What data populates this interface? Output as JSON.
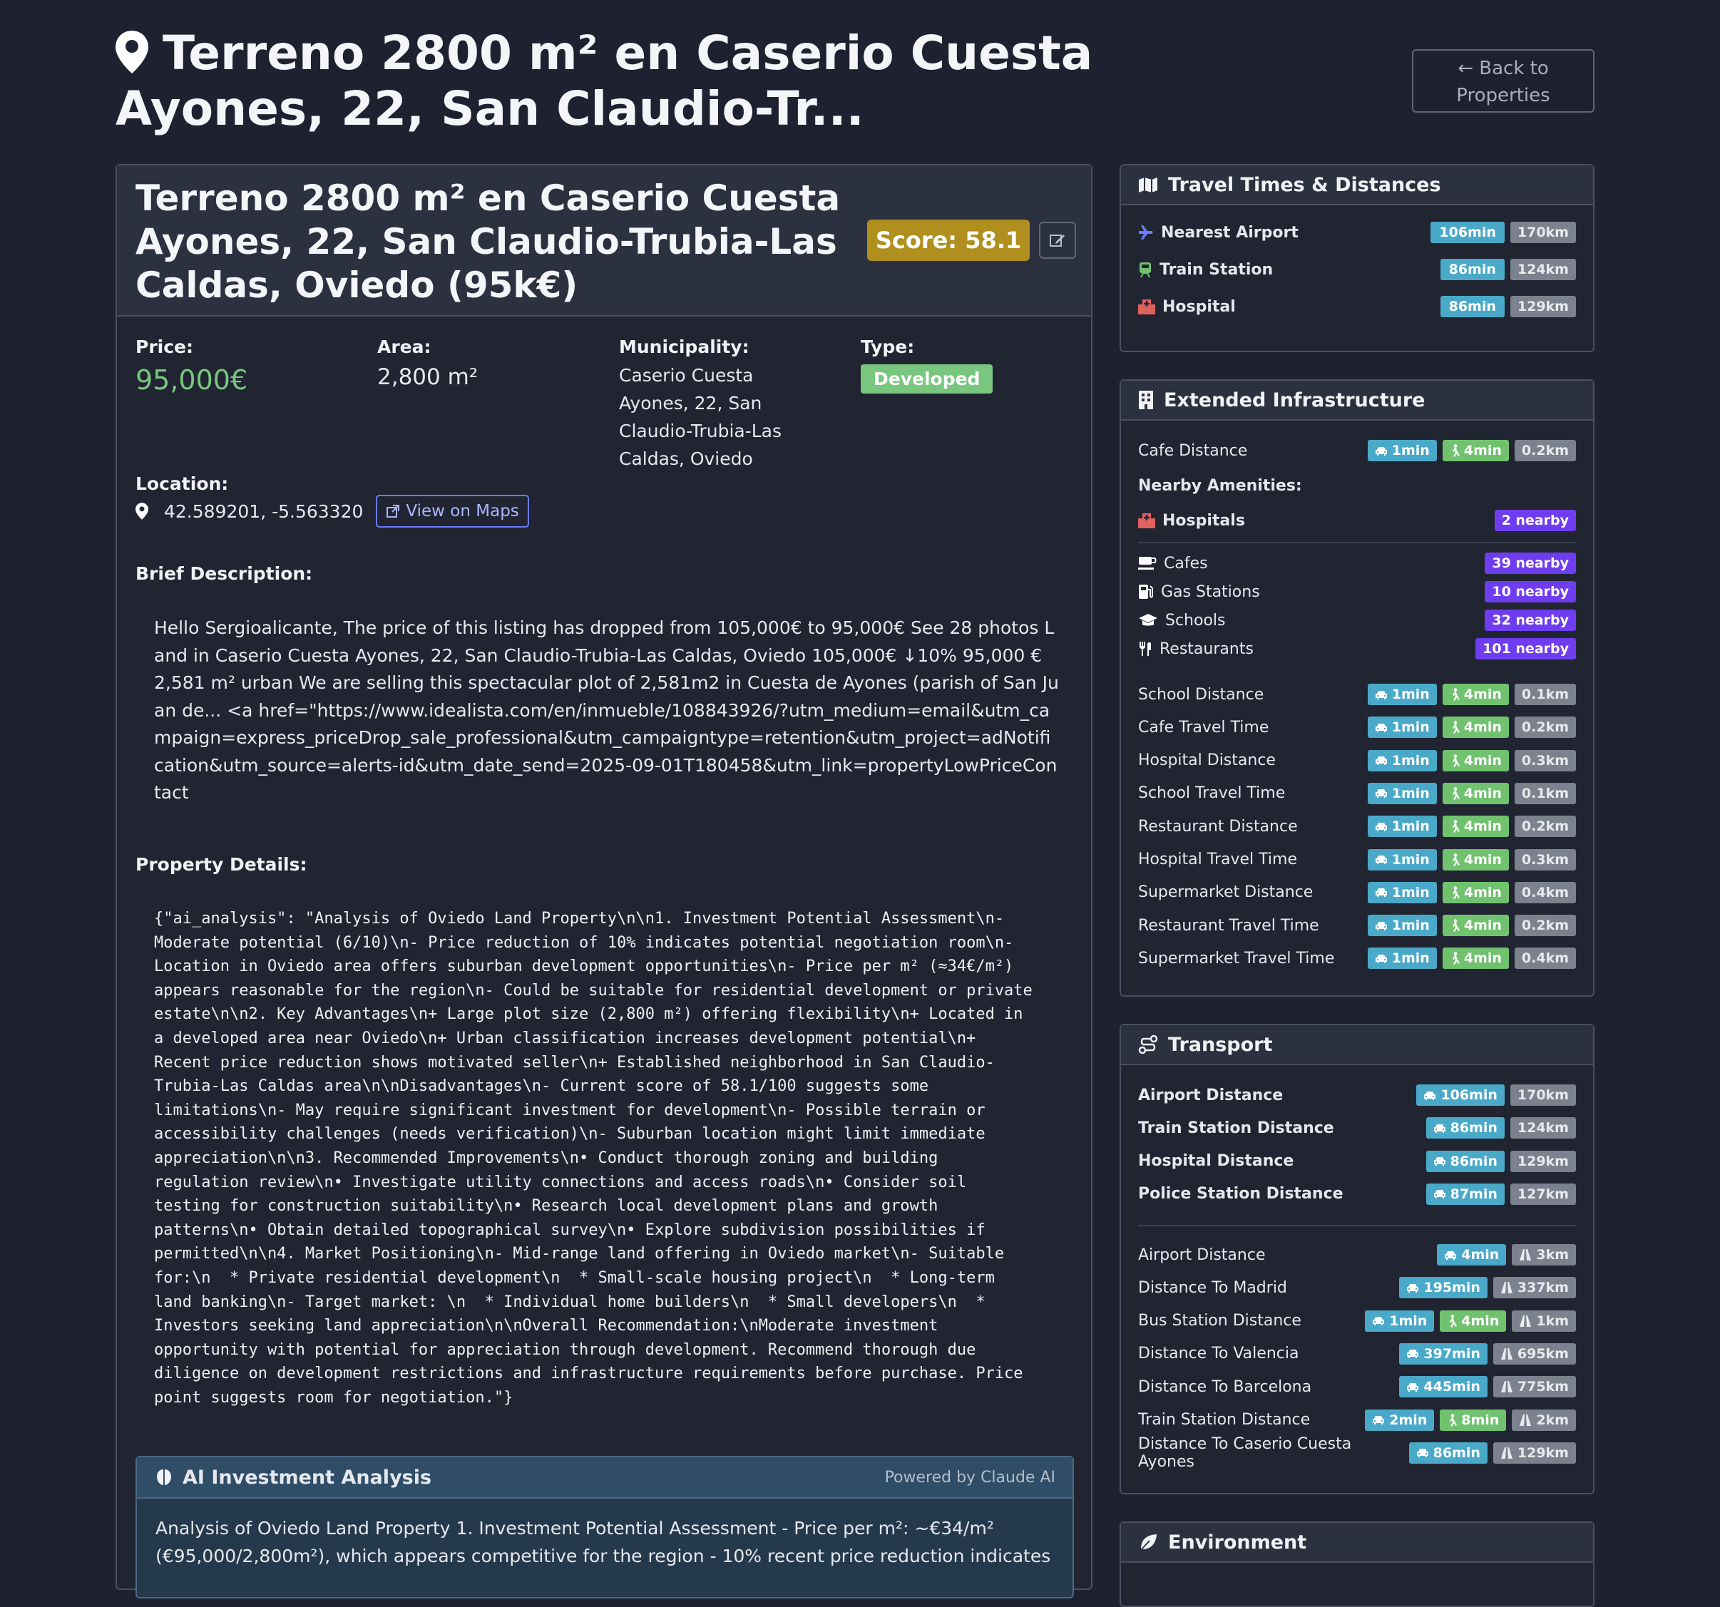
{
  "page": {
    "title": "Terreno 2800 m² en Caserio Cuesta Ayones, 22, San Claudio-Tr...",
    "back_label": "Back to Properties"
  },
  "property": {
    "heading": "Terreno 2800 m² en Caserio Cuesta Ayones, 22, San Claudio-Trubia-Las Caldas, Oviedo (95k€)",
    "score_label": "Score: 58.1",
    "price_label": "Price:",
    "price": "95,000€",
    "area_label": "Area:",
    "area": "2,800 m²",
    "municipality_label": "Municipality:",
    "municipality": "Caserio Cuesta Ayones, 22, San Claudio-Trubia-Las Caldas, Oviedo",
    "type_label": "Type:",
    "type": "Developed",
    "location_label": "Location:",
    "coords": "42.589201, -5.563320",
    "maps_label": "View on Maps",
    "brief_label": "Brief Description:",
    "brief": "Hello Sergioalicante, The price of this listing has dropped from 105,000€ to 95,000€ See 28 photos Land in Caserio Cuesta Ayones, 22, San Claudio-Trubia-Las Caldas, Oviedo 105,000€ ↓10% 95,000 € 2,581 m² urban We are selling this spectacular plot of 2,581m2 in Cuesta de Ayones (parish of San Juan de... <a href=\"https://www.idealista.com/en/inmueble/108843926/?utm_medium=email&utm_campaign=express_priceDrop_sale_professional&utm_campaigntype=retention&utm_project=adNotification&utm_source=alerts-id&utm_date_send=2025-09-01T180458&utm_link=propertyLowPriceContact",
    "details_label": "Property Details:",
    "details": "{\"ai_analysis\": \"Analysis of Oviedo Land Property\\n\\n1. Investment Potential Assessment\\n-\nModerate potential (6/10)\\n- Price reduction of 10% indicates potential negotiation room\\n-\nLocation in Oviedo area offers suburban development opportunities\\n- Price per m² (≈34€/m²)\nappears reasonable for the region\\n- Could be suitable for residential development or private\nestate\\n\\n2. Key Advantages\\n+ Large plot size (2,800 m²) offering flexibility\\n+ Located in\na developed area near Oviedo\\n+ Urban classification increases development potential\\n+\nRecent price reduction shows motivated seller\\n+ Established neighborhood in San Claudio-\nTrubia-Las Caldas area\\n\\nDisadvantages\\n- Current score of 58.1/100 suggests some\nlimitations\\n- May require significant investment for development\\n- Possible terrain or\naccessibility challenges (needs verification)\\n- Suburban location might limit immediate\nappreciation\\n\\n3. Recommended Improvements\\n• Conduct thorough zoning and building\nregulation review\\n• Investigate utility connections and access roads\\n• Consider soil\ntesting for construction suitability\\n• Research local development plans and growth\npatterns\\n• Obtain detailed topographical survey\\n• Explore subdivision possibilities if\npermitted\\n\\n4. Market Positioning\\n- Mid-range land offering in Oviedo market\\n- Suitable\nfor:\\n  * Private residential development\\n  * Small-scale housing project\\n  * Long-term\nland banking\\n- Target market: \\n  * Individual home builders\\n  * Small developers\\n  *\nInvestors seeking land appreciation\\n\\nOverall Recommendation:\\nModerate investment\nopportunity with potential for appreciation through development. Recommend thorough due\ndiligence on development restrictions and infrastructure requirements before purchase. Price\npoint suggests room for negotiation.\"}",
    "ai_title": "AI Investment Analysis",
    "ai_powered": "Powered by Claude AI",
    "ai_text": "Analysis of Oviedo Land Property 1. Investment Potential Assessment - Price per m²: ~€34/m² (€95,000/2,800m²), which appears competitive for the region - 10% recent price reduction indicates"
  },
  "travel": {
    "title": "Travel Times & Distances",
    "rows": [
      {
        "label": "Nearest Airport",
        "time": "106min",
        "dist": "170km",
        "icon": "plane-icon",
        "color": "#6b7cff"
      },
      {
        "label": "Train Station",
        "time": "86min",
        "dist": "124km",
        "icon": "train-icon",
        "color": "#71c26f"
      },
      {
        "label": "Hospital",
        "time": "86min",
        "dist": "129km",
        "icon": "hospital-icon",
        "color": "#e0625e"
      }
    ]
  },
  "infra": {
    "title": "Extended Infrastructure",
    "cafe": {
      "label": "Cafe Distance",
      "drive": "1min",
      "walk": "4min",
      "dist": "0.2km"
    },
    "amenities_label": "Nearby Amenities:",
    "hospitals": {
      "label": "Hospitals",
      "count": "2 nearby"
    },
    "amenities": [
      {
        "label": "Cafes",
        "count": "39 nearby",
        "icon": "coffee-icon"
      },
      {
        "label": "Gas Stations",
        "count": "10 nearby",
        "icon": "gas-pump-icon"
      },
      {
        "label": "Schools",
        "count": "32 nearby",
        "icon": "graduation-cap-icon"
      },
      {
        "label": "Restaurants",
        "count": "101 nearby",
        "icon": "utensils-icon"
      }
    ],
    "rows": [
      {
        "label": "School Distance",
        "drive": "1min",
        "walk": "4min",
        "dist": "0.1km"
      },
      {
        "label": "Cafe Travel Time",
        "drive": "1min",
        "walk": "4min",
        "dist": "0.2km"
      },
      {
        "label": "Hospital Distance",
        "drive": "1min",
        "walk": "4min",
        "dist": "0.3km"
      },
      {
        "label": "School Travel Time",
        "drive": "1min",
        "walk": "4min",
        "dist": "0.1km"
      },
      {
        "label": "Restaurant Distance",
        "drive": "1min",
        "walk": "4min",
        "dist": "0.2km"
      },
      {
        "label": "Hospital Travel Time",
        "drive": "1min",
        "walk": "4min",
        "dist": "0.3km"
      },
      {
        "label": "Supermarket Distance",
        "drive": "1min",
        "walk": "4min",
        "dist": "0.4km"
      },
      {
        "label": "Restaurant Travel Time",
        "drive": "1min",
        "walk": "4min",
        "dist": "0.2km"
      },
      {
        "label": "Supermarket Travel Time",
        "drive": "1min",
        "walk": "4min",
        "dist": "0.4km"
      }
    ]
  },
  "transport": {
    "title": "Transport",
    "main": [
      {
        "label": "Airport Distance",
        "drive": "106min",
        "dist": "170km"
      },
      {
        "label": "Train Station Distance",
        "drive": "86min",
        "dist": "124km"
      },
      {
        "label": "Hospital Distance",
        "drive": "86min",
        "dist": "129km"
      },
      {
        "label": "Police Station Distance",
        "drive": "87min",
        "dist": "127km"
      }
    ],
    "rows": [
      {
        "label": "Airport Distance",
        "drive": "4min",
        "walk": "",
        "dist": "3km"
      },
      {
        "label": "Distance To Madrid",
        "drive": "195min",
        "walk": "",
        "dist": "337km"
      },
      {
        "label": "Bus Station Distance",
        "drive": "1min",
        "walk": "4min",
        "dist": "1km"
      },
      {
        "label": "Distance To Valencia",
        "drive": "397min",
        "walk": "",
        "dist": "695km"
      },
      {
        "label": "Distance To Barcelona",
        "drive": "445min",
        "walk": "",
        "dist": "775km"
      },
      {
        "label": "Train Station Distance",
        "drive": "2min",
        "walk": "8min",
        "dist": "2km"
      },
      {
        "label": "Distance To Caserio Cuesta Ayones",
        "drive": "86min",
        "walk": "",
        "dist": "129km"
      }
    ]
  },
  "environment": {
    "title": "Environment"
  }
}
